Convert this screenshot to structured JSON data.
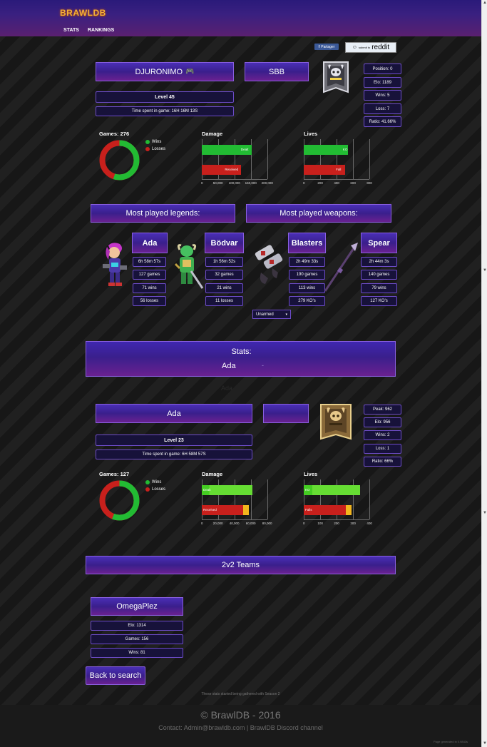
{
  "header": {
    "logo": "BRAWLDB",
    "nav": [
      "STATS",
      "RANKINGS"
    ]
  },
  "share": {
    "facebook": "Partager",
    "reddit_small": "submit to",
    "reddit": "reddit"
  },
  "player": {
    "name": "DJURONIMO",
    "clan": "SBB",
    "level": "Level 45",
    "time": "Time spent in game: 16H 16M 13S",
    "position": "Position: 0",
    "elo": "Elo: 1189",
    "wins": "Wins: 5",
    "loss": "Loss: 7",
    "ratio": "Ratio: 41.66%",
    "rank_badge": "silver-rank-icon"
  },
  "games_chart": {
    "title": "Games: 276",
    "legend": [
      "Wins",
      "Losses"
    ],
    "wins_fraction": 0.55,
    "colors": {
      "wins": "#22bb33",
      "losses": "#c8201c"
    }
  },
  "damage_chart": {
    "title": "Damage",
    "ticks": [
      "0",
      "50,000",
      "100,000",
      "150,000",
      "200,000"
    ],
    "bars": [
      {
        "label": "Dealt",
        "value": 152000,
        "color": "#22bb33"
      },
      {
        "label": "Received",
        "value": 120000,
        "color": "#c8201c"
      }
    ],
    "max": 200000
  },
  "lives_chart": {
    "title": "Lives",
    "ticks": [
      "0",
      "200",
      "400",
      "600",
      "800"
    ],
    "bars": [
      {
        "label": "KO",
        "value": 540,
        "color": "#22bb33"
      },
      {
        "label": "Fall",
        "value": 500,
        "color": "#c8201c"
      }
    ],
    "max": 800
  },
  "sections": {
    "legends": "Most played legends:",
    "weapons": "Most played weapons:"
  },
  "legends": [
    {
      "name": "Ada",
      "time": "6h 58m 57s",
      "games": "127 games",
      "wins": "71 wins",
      "losses": "56 losses"
    },
    {
      "name": "Bödvar",
      "time": "1h 56m 52s",
      "games": "32 games",
      "wins": "21 wins",
      "losses": "11 losses"
    }
  ],
  "weapons": [
    {
      "name": "Blasters",
      "time": "2h 49m 33s",
      "games": "190 games",
      "wins": "113 wins",
      "kos": "279 KO's"
    },
    {
      "name": "Spear",
      "time": "2h 44m 3s",
      "games": "140 games",
      "wins": "79 wins",
      "kos": "127 KO's"
    }
  ],
  "weapon_select": "Unarmed",
  "stats_panel": {
    "title": "Stats:",
    "legend": "Ada",
    "dash": "-",
    "ghost": "Ada"
  },
  "legend_stats": {
    "name": "Ada",
    "level": "Level 23",
    "time": "Time spent in game: 6H 58M 57S",
    "peak": "Peak: 962",
    "elo": "Elo: 956",
    "wins": "Wins: 2",
    "loss": "Loss: 1",
    "ratio": "Ratio: 66%",
    "rank_badge": "bronze-rank-icon"
  },
  "legend_games_chart": {
    "title": "Games: 127",
    "legend": [
      "Wins",
      "Losses"
    ],
    "wins_fraction": 0.56
  },
  "legend_damage_chart": {
    "title": "Damage",
    "ticks": [
      "0",
      "20,000",
      "40,000",
      "60,000",
      "80,000"
    ],
    "bars": [
      {
        "label": "Dealt",
        "value": 62000,
        "color": "#44cc22"
      },
      {
        "label": "Received",
        "value": 57000,
        "color": "#c8201c"
      }
    ],
    "max": 80000
  },
  "legend_lives_chart": {
    "title": "Lives",
    "ticks": [
      "0",
      "100",
      "200",
      "300",
      "400"
    ],
    "bars": [
      {
        "label": "KO",
        "value": 345,
        "color": "#44cc22"
      },
      {
        "label": "Falls",
        "value": 290,
        "color": "#c8201c"
      }
    ],
    "max": 400
  },
  "teams": {
    "title": "2v2 Teams",
    "partner": "OmegaPlez",
    "elo": "Elo: 1314",
    "games": "Games: 156",
    "wins": "Wins: 81"
  },
  "back_button": "Back to search",
  "footnote": "These stats started being gathered with Season 2",
  "footer": {
    "copyright": "© BrawlDB - 2016",
    "contact": "Contact: Admin@brawldb.com | BrawlDB Discord channel",
    "generated": "Page generated in 0.9843s"
  }
}
